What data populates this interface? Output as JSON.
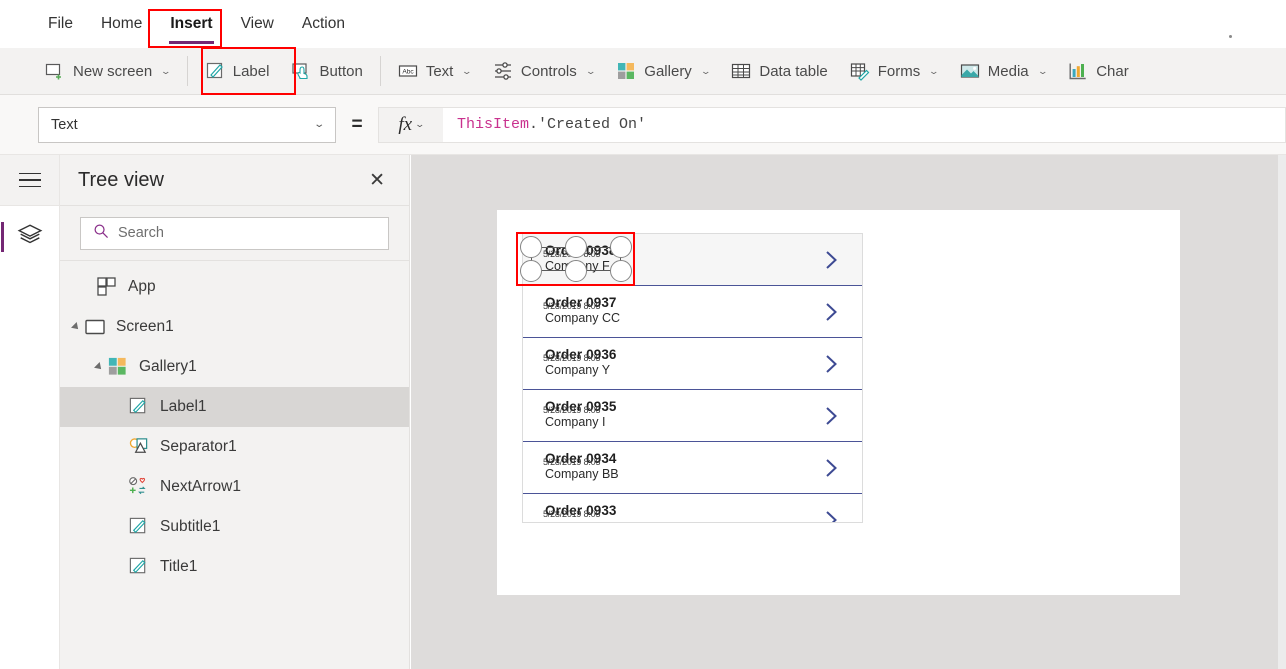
{
  "menu": {
    "items": [
      {
        "label": "File",
        "active": false
      },
      {
        "label": "Home",
        "active": false
      },
      {
        "label": "Insert",
        "active": true
      },
      {
        "label": "View",
        "active": false
      },
      {
        "label": "Action",
        "active": false
      }
    ]
  },
  "ribbon": {
    "new_screen": {
      "label": "New screen",
      "icon": "new-screen-icon",
      "chevron": "⌄"
    },
    "items": [
      {
        "label": "Label",
        "icon": "label-icon",
        "chevron": ""
      },
      {
        "label": "Button",
        "icon": "button-icon",
        "chevron": ""
      },
      {
        "label": "Text",
        "icon": "text-abc-icon",
        "chevron": "⌄"
      },
      {
        "label": "Controls",
        "icon": "controls-sliders-icon",
        "chevron": "⌄"
      },
      {
        "label": "Gallery",
        "icon": "gallery-grid-icon",
        "chevron": "⌄"
      },
      {
        "label": "Data table",
        "icon": "data-table-icon",
        "chevron": ""
      },
      {
        "label": "Forms",
        "icon": "forms-icon",
        "chevron": "⌄"
      },
      {
        "label": "Media",
        "icon": "media-image-icon",
        "chevron": "⌄"
      },
      {
        "label": "Char",
        "icon": "charts-icon",
        "chevron": ""
      }
    ]
  },
  "formula_bar": {
    "property": "Text",
    "property_chevron": "⌄",
    "equals": "=",
    "fx_label": "fx",
    "fx_chevron": "⌄",
    "formula_identifier": "ThisItem",
    "formula_rest": ".'Created On'"
  },
  "tree_view": {
    "title": "Tree view",
    "close_label": "✕",
    "search_placeholder": "Search",
    "search_value": "",
    "nodes": [
      {
        "label": "App",
        "icon": "app-icon",
        "depth": 0,
        "caret": false,
        "selected": false
      },
      {
        "label": "Screen1",
        "icon": "screen-icon",
        "depth": 0,
        "caret": true,
        "selected": false
      },
      {
        "label": "Gallery1",
        "icon": "gallery-grid-icon",
        "depth": 1,
        "caret": true,
        "selected": false
      },
      {
        "label": "Label1",
        "icon": "label-icon",
        "depth": 2,
        "caret": false,
        "selected": true
      },
      {
        "label": "Separator1",
        "icon": "separator-icon",
        "depth": 2,
        "caret": false,
        "selected": false
      },
      {
        "label": "NextArrow1",
        "icon": "next-arrow-icon",
        "depth": 2,
        "caret": false,
        "selected": false
      },
      {
        "label": "Subtitle1",
        "icon": "label-icon",
        "depth": 2,
        "caret": false,
        "selected": false
      },
      {
        "label": "Title1",
        "icon": "label-icon",
        "depth": 2,
        "caret": false,
        "selected": false
      }
    ]
  },
  "canvas": {
    "gallery_rows": [
      {
        "title": "Order 0938",
        "subtitle": "Company F",
        "date": "5/28/2019 8:05",
        "chevron": "next-arrow-icon",
        "selected": true
      },
      {
        "title": "Order 0937",
        "subtitle": "Company CC",
        "date": "5/28/2019 8:05",
        "chevron": "next-arrow-icon",
        "selected": false
      },
      {
        "title": "Order 0936",
        "subtitle": "Company Y",
        "date": "5/28/2019 8:05",
        "chevron": "next-arrow-icon",
        "selected": false
      },
      {
        "title": "Order 0935",
        "subtitle": "Company I",
        "date": "5/28/2019 8:05",
        "chevron": "next-arrow-icon",
        "selected": false
      },
      {
        "title": "Order 0934",
        "subtitle": "Company BB",
        "date": "5/28/2019 8:05",
        "chevron": "next-arrow-icon",
        "selected": false
      },
      {
        "title": "Order 0933",
        "subtitle": "",
        "date": "5/28/2019 8:05",
        "chevron": "next-arrow-icon",
        "selected": false
      }
    ]
  },
  "rail": {
    "hamburger": "hamburger-menu-icon",
    "layers": "layers-icon"
  },
  "colors": {
    "accent_purple": "#742774",
    "highlight_red": "#ff0000",
    "gallery_blue": "#4b5497",
    "ribbon_bg": "#f3f2f1",
    "canvas_bg": "#dedcdb",
    "formula_identifier": "#c9318e"
  }
}
